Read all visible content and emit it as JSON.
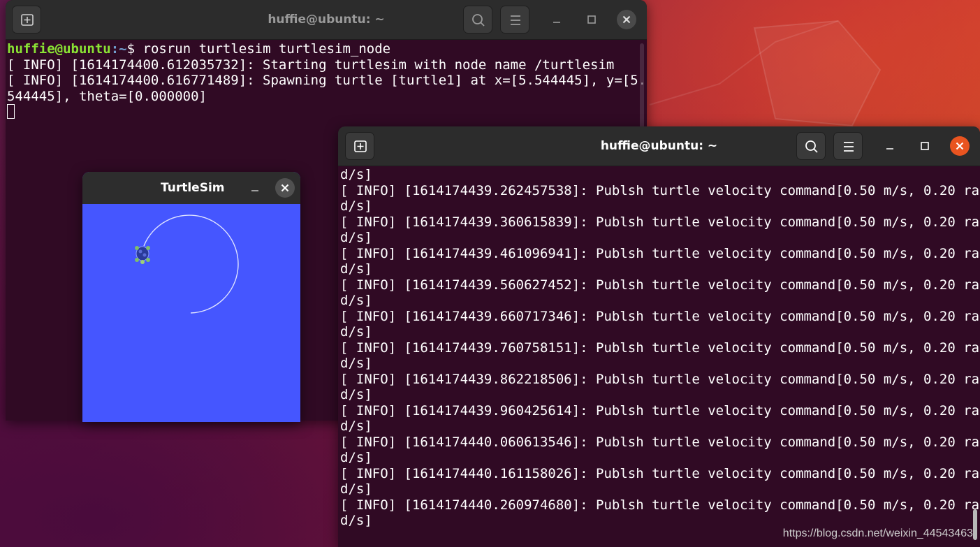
{
  "terminal1": {
    "title": "huffie@ubuntu: ~",
    "prompt_user": "huffie@ubuntu",
    "prompt_path": ":~",
    "prompt_symbol": "$ ",
    "command": "rosrun turtlesim turtlesim_node",
    "lines": [
      "[ INFO] [1614174400.612035732]: Starting turtlesim with node name /turtlesim",
      "[ INFO] [1614174400.616771489]: Spawning turtle [turtle1] at x=[5.544445], y=[5.",
      "544445], theta=[0.000000]"
    ],
    "buttons": {
      "new_tab_icon": "new-tab-icon",
      "search_icon": "search-icon",
      "menu_icon": "hamburger-menu-icon"
    }
  },
  "turtlesim": {
    "title": "TurtleSim",
    "canvas_color": "#4556ff",
    "path_color": "#dfe3ff"
  },
  "terminal2": {
    "title": "huffie@ubuntu: ~",
    "first_line": "d/s]",
    "log_lines": [
      {
        "text": "[ INFO] [1614174439.262457538]: Publsh turtle velocity command[0.50 m/s, 0.20 ra",
        "wrap": "d/s]"
      },
      {
        "text": "[ INFO] [1614174439.360615839]: Publsh turtle velocity command[0.50 m/s, 0.20 ra",
        "wrap": "d/s]"
      },
      {
        "text": "[ INFO] [1614174439.461096941]: Publsh turtle velocity command[0.50 m/s, 0.20 ra",
        "wrap": "d/s]"
      },
      {
        "text": "[ INFO] [1614174439.560627452]: Publsh turtle velocity command[0.50 m/s, 0.20 ra",
        "wrap": "d/s]"
      },
      {
        "text": "[ INFO] [1614174439.660717346]: Publsh turtle velocity command[0.50 m/s, 0.20 ra",
        "wrap": "d/s]"
      },
      {
        "text": "[ INFO] [1614174439.760758151]: Publsh turtle velocity command[0.50 m/s, 0.20 ra",
        "wrap": "d/s]"
      },
      {
        "text": "[ INFO] [1614174439.862218506]: Publsh turtle velocity command[0.50 m/s, 0.20 ra",
        "wrap": "d/s]"
      },
      {
        "text": "[ INFO] [1614174439.960425614]: Publsh turtle velocity command[0.50 m/s, 0.20 ra",
        "wrap": "d/s]"
      },
      {
        "text": "[ INFO] [1614174440.060613546]: Publsh turtle velocity command[0.50 m/s, 0.20 ra",
        "wrap": "d/s]"
      },
      {
        "text": "[ INFO] [1614174440.161158026]: Publsh turtle velocity command[0.50 m/s, 0.20 ra",
        "wrap": "d/s]"
      },
      {
        "text": "[ INFO] [1614174440.260974680]: Publsh turtle velocity command[0.50 m/s, 0.20 ra",
        "wrap": "d/s]"
      }
    ]
  },
  "watermark": "https://blog.csdn.net/weixin_44543463",
  "colors": {
    "terminal_bg": "#300a24",
    "titlebar_bg": "#2c2c2c",
    "close_active": "#e95420",
    "prompt_user": "#8ae234",
    "prompt_path": "#729fcf"
  }
}
